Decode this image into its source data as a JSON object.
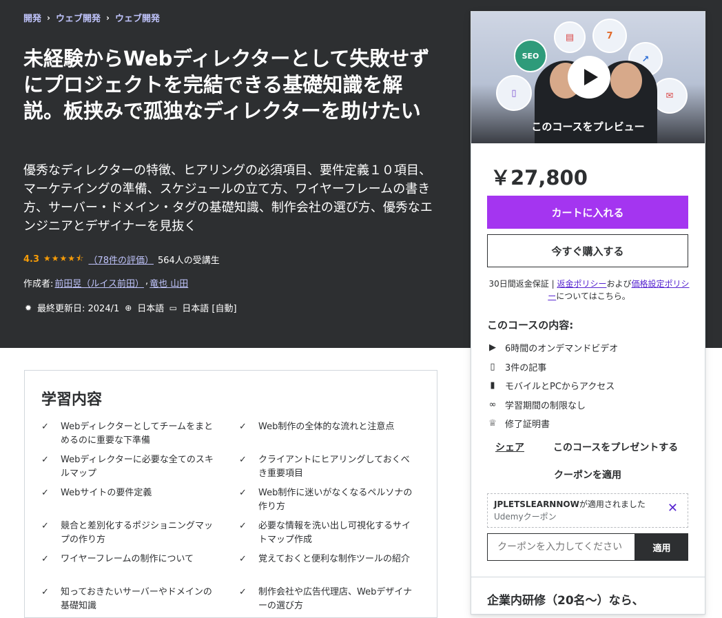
{
  "breadcrumb": [
    "開発",
    "ウェブ開発",
    "ウェブ開発"
  ],
  "course": {
    "title": "未経験からWebディレクターとして失敗せずにプロジェクトを完結できる基礎知識を解説。板挟みで孤独なディレクターを助けたい",
    "subtitle": "優秀なディレクターの特徴、ヒアリングの必須項目、要件定義１０項目、マーケテイングの準備、スケジュールの立て方、ワイヤーフレームの書き方、サーバー・ドメイン・タグの基礎知識、制作会社の選び方、優秀なエンジニアとデザイナーを見抜く",
    "rating": "4.3",
    "rating_value": 4.3,
    "stars": "★★★★⯪",
    "rating_count": "（78件の評価）",
    "students": "564人の受講生",
    "author_label": "作成者:",
    "authors": [
      "前田昱（ルイス前田）",
      "竜也 山田"
    ],
    "last_updated": "最終更新日: 2024/1",
    "language": "日本語",
    "captions": "日本語 [自動]"
  },
  "sidebar": {
    "preview_label": "このコースをプレビュー",
    "price": "￥27,800",
    "add_to_cart": "カートに入れる",
    "buy_now": "今すぐ購入する",
    "refund_text": "30日間返金保証 | ",
    "refund_link": "返金ポリシー",
    "refund_and": "および",
    "pricing_link": "価格設定ポリシー",
    "refund_tail": "についてはこちら。",
    "includes_title": "このコースの内容:",
    "includes": [
      {
        "icon": "video-icon",
        "label": "6時間のオンデマンドビデオ"
      },
      {
        "icon": "file-icon",
        "label": "3件の記事"
      },
      {
        "icon": "mobile-icon",
        "label": "モバイルとPCからアクセス"
      },
      {
        "icon": "infinity-icon",
        "label": "学習期間の制限なし"
      },
      {
        "icon": "trophy-icon",
        "label": "修了証明書"
      }
    ],
    "share": "シェア",
    "gift": "このコースをプレゼントする",
    "apply_coupon": "クーポンを適用",
    "coupon_code": "JPLETSLEARNNOW",
    "coupon_applied": "が適用されました",
    "coupon_type": "Udemyクーポン",
    "coupon_placeholder": "クーポンを入力してください",
    "coupon_button": "適用",
    "business_title": "企業内研修（20名〜）なら、"
  },
  "learn": {
    "title": "学習内容",
    "items": [
      "Webディレクターとしてチームをまとめるのに重要な下準備",
      "Web制作の全体的な流れと注意点",
      "Webディレクターに必要な全てのスキルマップ",
      "クライアントにヒアリングしておくべき重要項目",
      "Webサイトの要件定義",
      "Web制作に迷いがなくなるペルソナの作り方",
      "競合と差別化するポジショニングマップの作り方",
      "必要な情報を洗い出し可視化するサイトマップ作成",
      "ワイヤーフレームの制作について",
      "覚えておくと便利な制作ツールの紹介",
      "知っておきたいサーバーやドメインの基礎知識",
      "制作会社や広告代理店、Webデザイナーの選び方"
    ]
  },
  "colors": {
    "hero_bg": "#2d2f31",
    "accent_purple": "#a435f0",
    "link_lavender": "#c0c4fc",
    "star_orange": "#f69c08"
  }
}
